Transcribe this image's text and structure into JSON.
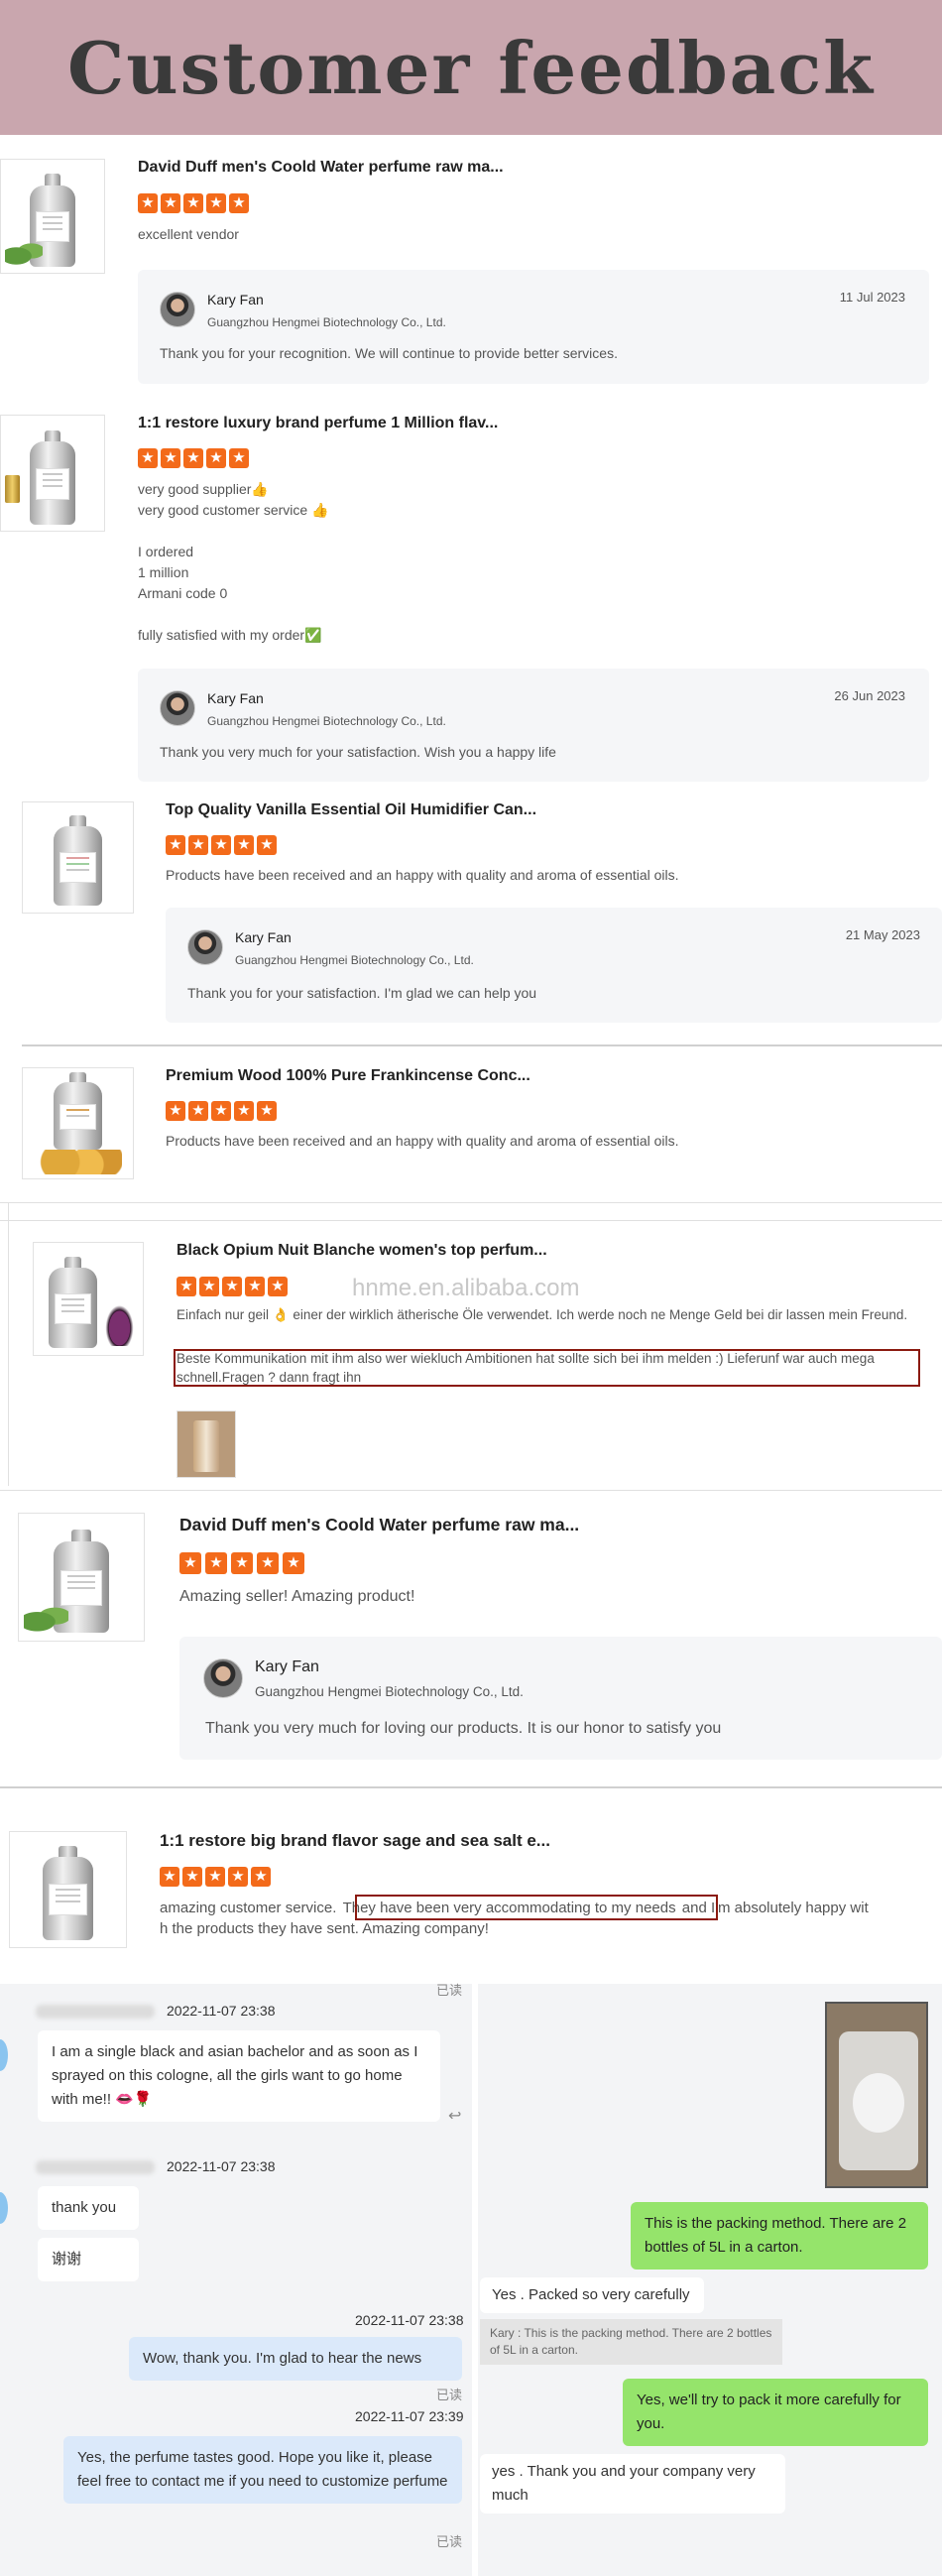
{
  "banner": {
    "title": "Customer feedback"
  },
  "watermark": "hnme.en.alibaba.com",
  "reply_common": {
    "name": "Kary Fan",
    "company": "Guangzhou Hengmei Biotechnology Co., Ltd."
  },
  "reviews": [
    {
      "title": "David Duff men's Coold Water perfume raw ma...",
      "rating": 5,
      "text": "excellent vendor",
      "reply": {
        "date": "11 Jul 2023",
        "message": "Thank you for your recognition. We will continue to provide better services."
      }
    },
    {
      "title": "1:1 restore luxury brand perfume 1 Million flav...",
      "rating": 5,
      "text": "very good supplier👍\n very good customer service 👍\n\nI ordered\n1 million\nArmani code 0\n\nfully satisfied with my order✅",
      "reply": {
        "date": "26 Jun 2023",
        "message": "Thank you very much for your satisfaction. Wish you a happy life"
      }
    },
    {
      "title": "Top Quality Vanilla Essential Oil Humidifier Can...",
      "rating": 5,
      "text": "Products have been received and an happy with quality and aroma of essential oils.",
      "reply": {
        "date": "21 May 2023",
        "message": "Thank you for your satisfaction. I'm glad we can help you"
      }
    },
    {
      "title": "Premium Wood 100% Pure Frankincense Conc...",
      "rating": 5,
      "text": "Products have been received and an happy with quality and aroma of essential oils."
    },
    {
      "title": "Black Opium Nuit Blanche women's top perfum...",
      "rating": 5,
      "text": "Einfach nur geil 👌 einer der wirklich ätherische Öle verwendet. Ich werde noch ne Menge Geld bei dir lassen mein Freund.",
      "text2": "Beste Kommunikation mit ihm also wer wiekluch Ambitionen hat sollte sich bei ihm melden :) Lieferunf war auch mega schnell.Fragen ? dann fragt ihn"
    },
    {
      "title": "David Duff men's Coold Water perfume raw ma...",
      "rating": 5,
      "text": "Amazing seller! Amazing product!",
      "reply": {
        "message": "Thank you very much for loving our products. It is our honor to satisfy you"
      }
    },
    {
      "title": "1:1 restore big brand flavor sage and sea salt e...",
      "rating": 5,
      "text_a": "amazing customer service.",
      "text_b": "They have been very accommodating to my needs",
      "text_c": "and I'm absolutely happy wit",
      "text_d": "h the products they have sent. Amazing company!"
    }
  ],
  "chat_left": {
    "ts1": "2022-11-07 23:38",
    "msg1": "I am a single black and asian bachelor and as soon as I sprayed on this cologne, all the girls want to go home with me!! 👄🌹",
    "ts2": "2022-11-07 23:38",
    "msg2": "thank you",
    "msg3": "谢谢",
    "ts3": "2022-11-07 23:38",
    "msg4": "Wow, thank you. I'm glad to hear the news",
    "read1": "已读",
    "ts4": "2022-11-07 23:39",
    "msg5": "Yes, the perfume tastes good. Hope you like it, please feel free to contact me if you need to customize perfume",
    "read2": "已读",
    "read0": "已读"
  },
  "chat_right": {
    "msg1": "This is the packing method. There are 2 bottles of 5L in a carton.",
    "msg2": "Yes . Packed so very carefully",
    "quote": "Kary : This is the packing method. There are 2 bottles of 5L in a carton.",
    "msg3": "Yes, we'll try to pack it more carefully for you.",
    "msg4": "yes .  Thank you and your company very much"
  },
  "colors": {
    "banner": "#c9a6ae",
    "star": "#f36a1a",
    "highlight": "#8b1a10",
    "chat_green": "#95e46b",
    "chat_blue": "#dbe9fa"
  }
}
